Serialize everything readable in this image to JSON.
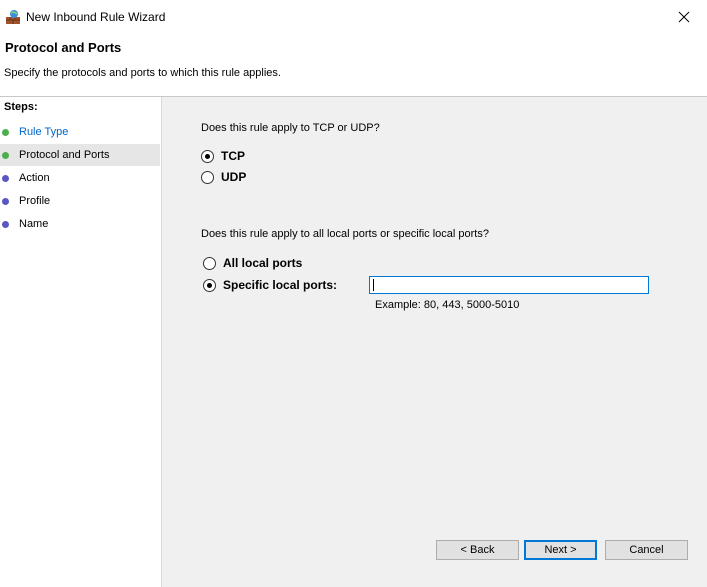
{
  "window": {
    "title": "New Inbound Rule Wizard",
    "close_glyph": "✕"
  },
  "header": {
    "title": "Protocol and Ports",
    "description": "Specify the protocols and ports to which this rule applies."
  },
  "steps": {
    "heading": "Steps:",
    "items": [
      {
        "label": "Rule Type",
        "state": "link",
        "dot_color": "#4cae4c"
      },
      {
        "label": "Protocol and Ports",
        "state": "current",
        "dot_color": "#4cae4c"
      },
      {
        "label": "Action",
        "state": "pending",
        "dot_color": "#5b57c2"
      },
      {
        "label": "Profile",
        "state": "pending",
        "dot_color": "#5b57c2"
      },
      {
        "label": "Name",
        "state": "pending",
        "dot_color": "#5b57c2"
      }
    ]
  },
  "protocol": {
    "question": "Does this rule apply to TCP or UDP?",
    "options": [
      {
        "label": "TCP",
        "checked": true
      },
      {
        "label": "UDP",
        "checked": false
      }
    ]
  },
  "ports": {
    "question": "Does this rule apply to all local ports or specific local ports?",
    "options": [
      {
        "label": "All local ports",
        "checked": false
      },
      {
        "label": "Specific local ports:",
        "checked": true
      }
    ],
    "input_value": "",
    "example": "Example: 80, 443, 5000-5010"
  },
  "buttons": {
    "back": "< Back",
    "next": "Next >",
    "cancel": "Cancel"
  },
  "colors": {
    "accent": "#0078d7",
    "link": "#0066cc"
  }
}
